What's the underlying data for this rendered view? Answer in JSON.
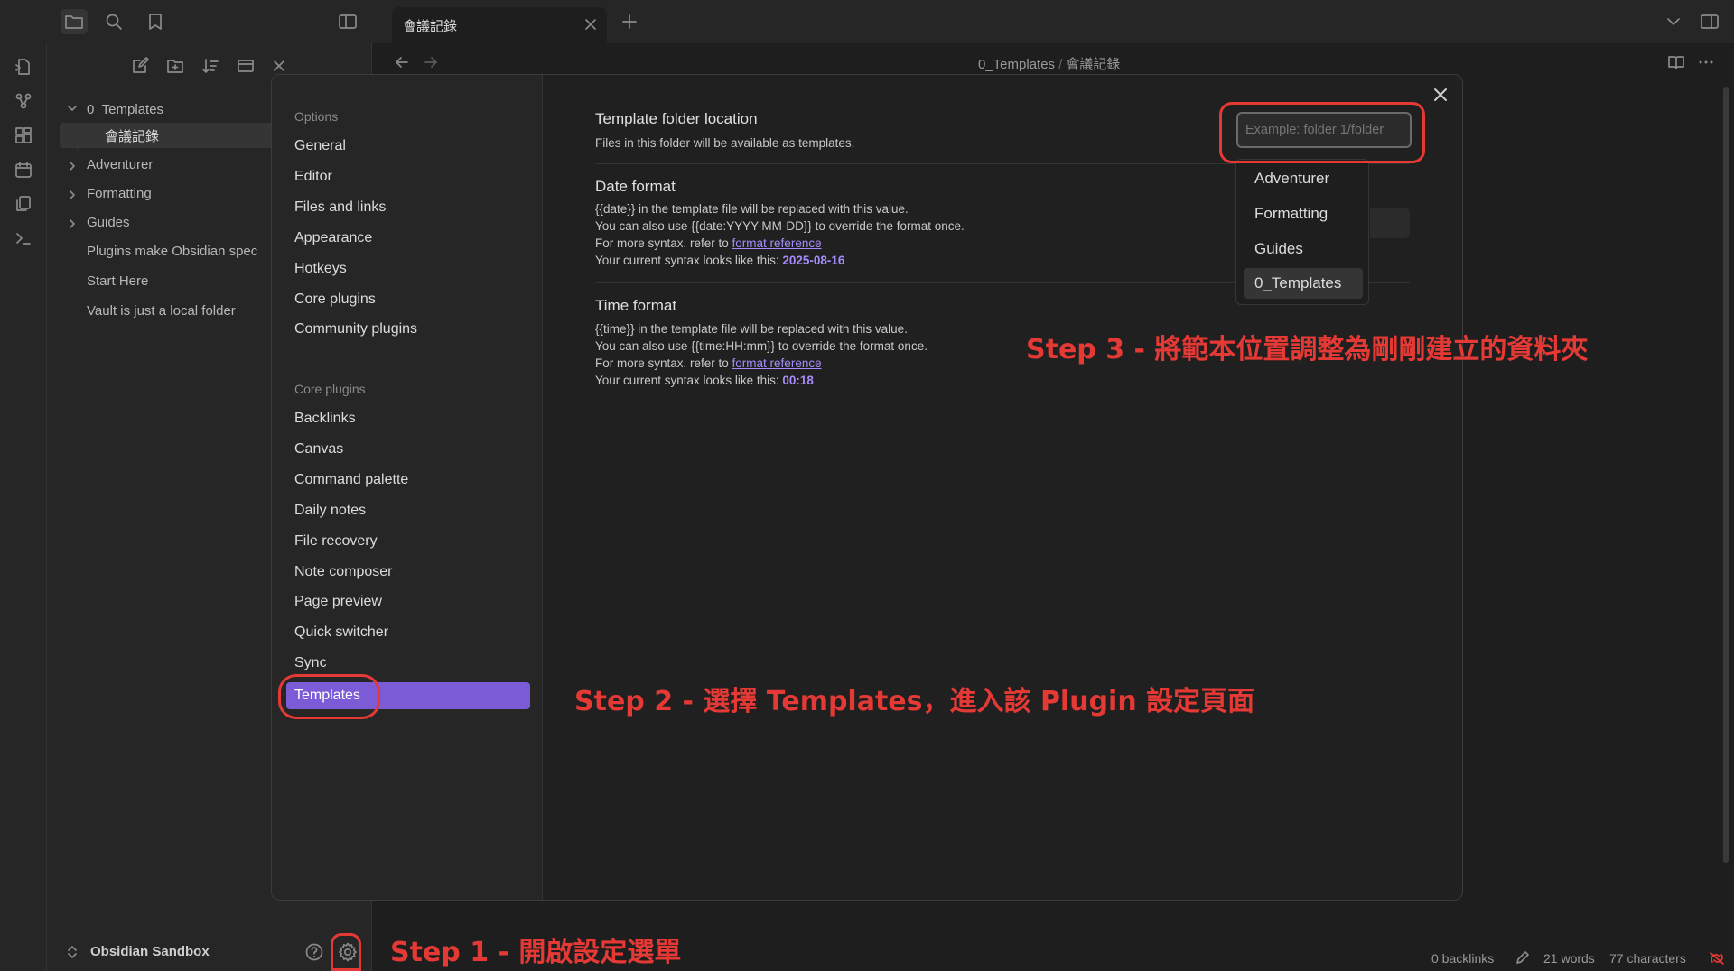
{
  "titlebar": {
    "tab_title": "會議記錄"
  },
  "explorer": {
    "tree": [
      {
        "label": "0_Templates",
        "type": "folder-open"
      },
      {
        "label": "會議記錄",
        "type": "file",
        "selected": true
      },
      {
        "label": "Adventurer",
        "type": "folder"
      },
      {
        "label": "Formatting",
        "type": "folder"
      },
      {
        "label": "Guides",
        "type": "folder"
      },
      {
        "label": "Plugins make Obsidian spec",
        "type": "file"
      },
      {
        "label": "Start Here",
        "type": "file"
      },
      {
        "label": "Vault is just a local folder",
        "type": "file"
      }
    ],
    "vault_name": "Obsidian Sandbox"
  },
  "breadcrumb": {
    "folder": "0_Templates",
    "separator": "/",
    "file": "會議記錄"
  },
  "settings": {
    "options_heading": "Options",
    "options": [
      "General",
      "Editor",
      "Files and links",
      "Appearance",
      "Hotkeys",
      "Core plugins",
      "Community plugins"
    ],
    "core_heading": "Core plugins",
    "core_plugins": [
      "Backlinks",
      "Canvas",
      "Command palette",
      "Daily notes",
      "File recovery",
      "Note composer",
      "Page preview",
      "Quick switcher",
      "Sync"
    ],
    "active_item": "Templates",
    "template_folder": {
      "title": "Template folder location",
      "desc": "Files in this folder will be available as templates.",
      "placeholder": "Example: folder 1/folder"
    },
    "date_format": {
      "title": "Date format",
      "line1": "{{date}} in the template file will be replaced with this value.",
      "line2": "You can also use {{date:YYYY-MM-DD}} to override the format once.",
      "line3_prefix": "For more syntax, refer to ",
      "link": "format reference",
      "line4_prefix": "Your current syntax looks like this: ",
      "value": "2025-08-16"
    },
    "time_format": {
      "title": "Time format",
      "line1": "{{time}} in the template file will be replaced with this value.",
      "line2": "You can also use {{time:HH:mm}} to override the format once.",
      "line3_prefix": "For more syntax, refer to ",
      "link": "format reference",
      "line4_prefix": "Your current syntax looks like this: ",
      "value": "00:18"
    },
    "suggestions": [
      "Adventurer",
      "Formatting",
      "Guides",
      "0_Templates"
    ]
  },
  "statusbar": {
    "backlinks": "0 backlinks",
    "words": "21 words",
    "characters": "77 characters"
  },
  "annotations": {
    "step1": "Step 1 - 開啟設定選單",
    "step2": "Step 2 - 選擇 Templates，進入該 Plugin 設定頁面",
    "step3": "Step 3 - 將範本位置調整為剛剛建立的資料夾",
    "color": "#e53935"
  },
  "colors": {
    "accent": "#7c5bd6",
    "link": "#a78bfa",
    "background": "#1e1e1e",
    "sidebar": "#262626"
  }
}
